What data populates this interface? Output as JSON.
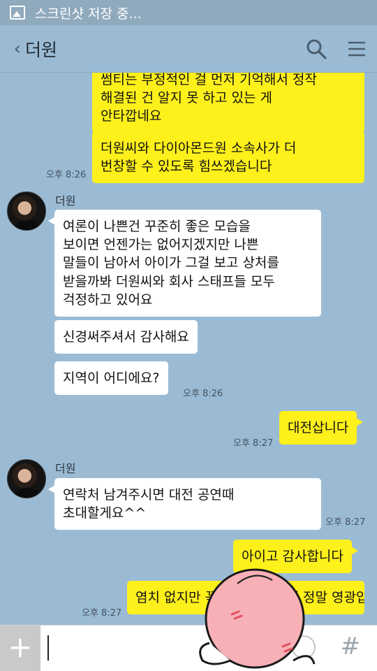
{
  "statusbar": {
    "notification_text": "스크린샷 저장 중..."
  },
  "header": {
    "back_glyph": "‹",
    "title": "더원",
    "search_icon": "search-icon",
    "menu_icon": "menu-icon"
  },
  "messages": {
    "m1": {
      "text": "썸티는 부정적인 걸 먼저 기억해서 정작\n해결된 건 알지 못 하고 있는 게\n안타깝네요"
    },
    "m2": {
      "text": "더원씨와 다이아몬드원 소속사가 더\n번창할 수 있도록 힘쓰겠습니다",
      "time": "오후 8:26"
    },
    "s1": {
      "sender": "더원"
    },
    "m3": {
      "text": "여론이 나쁜건 꾸준히 좋은 모습을\n보이면 언젠가는 없어지겠지만 나쁜\n말들이 남아서 아이가 그걸 보고 상처를\n받을까봐 더원씨와 회사 스태프들 모두\n걱정하고 있어요"
    },
    "m4": {
      "text": "신경써주셔서 감사해요"
    },
    "m5": {
      "text": "지역이 어디에요?",
      "time": "오후 8:26"
    },
    "m6": {
      "text": "대전삽니다",
      "time": "오후 8:27"
    },
    "s2": {
      "sender": "더원"
    },
    "m7": {
      "text": "연락처 남겨주시면 대전 공연때\n초대할게요^^",
      "time": "오후 8:27"
    },
    "m8": {
      "text": "아이고 감사합니다"
    },
    "m9": {
      "text": "염치 없지만 꼭 가고 싶었는데 정말 영광입니다!",
      "time": "오후 8:27"
    }
  },
  "input": {
    "plus_label": "+",
    "hash_label": "#",
    "value": ""
  },
  "colors": {
    "chat_background": "#9bbbd4",
    "my_bubble": "#fef01b",
    "other_bubble": "#ffffff"
  }
}
